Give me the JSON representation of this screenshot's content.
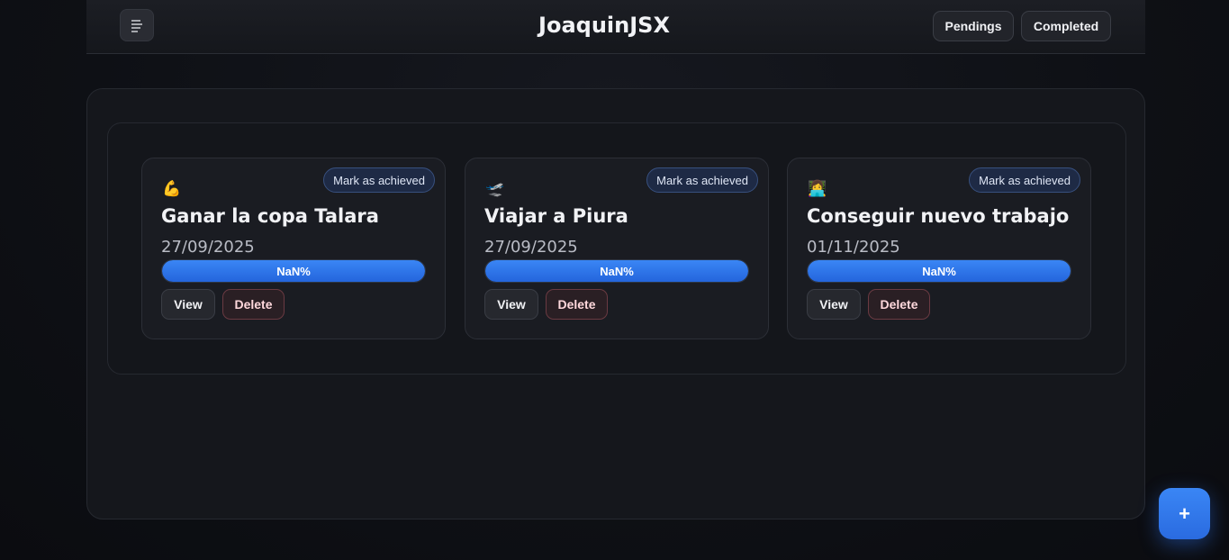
{
  "header": {
    "title": "JoaquinJSX",
    "menu_icon": "menu-lines-icon",
    "nav": [
      {
        "label": "Pendings"
      },
      {
        "label": "Completed"
      }
    ]
  },
  "goals": [
    {
      "emoji": "💪",
      "icon_name": "flexed-biceps-icon",
      "title": "Ganar la copa Talara",
      "date": "27/09/2025",
      "progress_text": "NaN%",
      "progress_fill": 1.0,
      "achieve_label": "Mark as achieved",
      "view_label": "View",
      "delete_label": "Delete"
    },
    {
      "emoji": "🛫",
      "icon_name": "airplane-departure-icon",
      "title": "Viajar a Piura",
      "date": "27/09/2025",
      "progress_text": "NaN%",
      "progress_fill": 1.0,
      "achieve_label": "Mark as achieved",
      "view_label": "View",
      "delete_label": "Delete"
    },
    {
      "emoji": "👩‍💻",
      "icon_name": "technologist-icon",
      "title": "Conseguir nuevo trabajo",
      "date": "01/11/2025",
      "progress_text": "NaN%",
      "progress_fill": 1.0,
      "achieve_label": "Mark as achieved",
      "view_label": "View",
      "delete_label": "Delete"
    }
  ],
  "fab": {
    "label": "+",
    "icon_name": "plus-icon"
  },
  "colors": {
    "accent": "#2f74ea",
    "background": "#0e1015",
    "danger_border": "#6a3a42"
  }
}
